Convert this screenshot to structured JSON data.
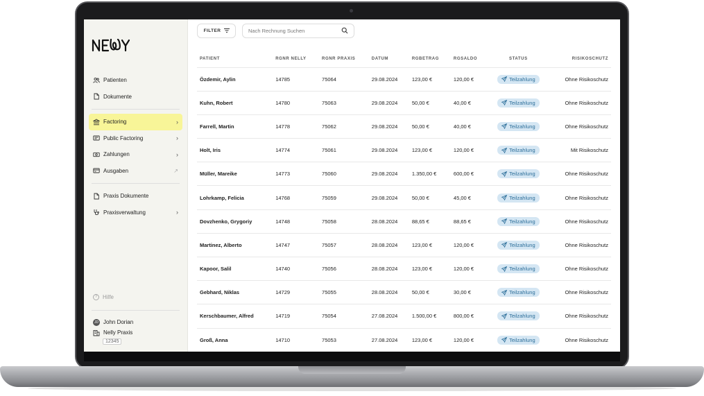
{
  "brand": {
    "logo_text": "NELLY"
  },
  "sidebar": {
    "items": [
      {
        "label": "Patienten",
        "icon": "users-icon",
        "chevron": false,
        "active": false
      },
      {
        "label": "Dokumente",
        "icon": "document-icon",
        "chevron": false,
        "active": false
      },
      {
        "label": "Factoring",
        "icon": "bank-icon",
        "chevron": true,
        "active": true
      },
      {
        "label": "Public Factoring",
        "icon": "receipt-icon",
        "chevron": true,
        "active": false
      },
      {
        "label": "Zahlungen",
        "icon": "cash-icon",
        "chevron": true,
        "active": false
      },
      {
        "label": "Ausgaben",
        "icon": "expenses-icon",
        "chevron": false,
        "external": true,
        "active": false
      },
      {
        "label": "Praxis Dokumente",
        "icon": "file-icon",
        "chevron": false,
        "active": false
      },
      {
        "label": "Praxisverwaltung",
        "icon": "stethoscope-icon",
        "chevron": true,
        "active": false
      }
    ],
    "help_label": "Hilfe",
    "user": {
      "initials": "JD",
      "name": "John Dorian",
      "praxis": "Nelly Praxis",
      "praxis_id": "12345"
    }
  },
  "toolbar": {
    "filter_label": "FILTER",
    "search_placeholder": "Nach Rechnung Suchen"
  },
  "table": {
    "columns": [
      "PATIENT",
      "RGNR NELLY",
      "RGNR PRAXIS",
      "DATUM",
      "RGBETRAG",
      "RGSALDO",
      "STATUS",
      "RISIKOSCHUTZ"
    ],
    "rows": [
      [
        "Özdemir, Aylin",
        "14785",
        "75064",
        "29.08.2024",
        "123,00 €",
        "120,00 €",
        "Teilzahlung",
        "Ohne Risikoschutz"
      ],
      [
        "Kuhn, Robert",
        "14780",
        "75063",
        "29.08.2024",
        "50,00 €",
        "40,00 €",
        "Teilzahlung",
        "Ohne Risikoschutz"
      ],
      [
        "Farrell, Martin",
        "14778",
        "75062",
        "29.08.2024",
        "50,00 €",
        "40,00 €",
        "Teilzahlung",
        "Ohne Risikoschutz"
      ],
      [
        "Holt, Iris",
        "14774",
        "75061",
        "29.08.2024",
        "123,00 €",
        "120,00 €",
        "Teilzahlung",
        "Mit Risikoschutz"
      ],
      [
        "Müller, Mareike",
        "14773",
        "75060",
        "29.08.2024",
        "1.350,00 €",
        "600,00 €",
        "Teilzahlung",
        "Ohne Risikoschutz"
      ],
      [
        "Lohrkamp, Felicia",
        "14768",
        "75059",
        "29.08.2024",
        "50,00 €",
        "45,00 €",
        "Teilzahlung",
        "Ohne Risikoschutz"
      ],
      [
        "Dovzhenko, Grygoriy",
        "14748",
        "75058",
        "28.08.2024",
        "88,65 €",
        "88,65 €",
        "Teilzahlung",
        "Ohne Risikoschutz"
      ],
      [
        "Martinez, Alberto",
        "14747",
        "75057",
        "28.08.2024",
        "123,00 €",
        "120,00 €",
        "Teilzahlung",
        "Ohne Risikoschutz"
      ],
      [
        "Kapoor, Salil",
        "14740",
        "75056",
        "28.08.2024",
        "123,00 €",
        "120,00 €",
        "Teilzahlung",
        "Ohne Risikoschutz"
      ],
      [
        "Gebhard, Niklas",
        "14729",
        "75055",
        "28.08.2024",
        "50,00 €",
        "30,00 €",
        "Teilzahlung",
        "Ohne Risikoschutz"
      ],
      [
        "Kerschbaumer, Alfred",
        "14719",
        "75054",
        "27.08.2024",
        "1.500,00 €",
        "800,00 €",
        "Teilzahlung",
        "Ohne Risikoschutz"
      ],
      [
        "Groß, Anna",
        "14710",
        "75053",
        "27.08.2024",
        "123,00 €",
        "120,00 €",
        "Teilzahlung",
        "Ohne Risikoschutz"
      ]
    ]
  },
  "colors": {
    "accent": "#f8f598",
    "status_bg": "#d4e6f3",
    "status_text": "#2d6f9a",
    "sidebar_bg": "#f4f4ef"
  }
}
